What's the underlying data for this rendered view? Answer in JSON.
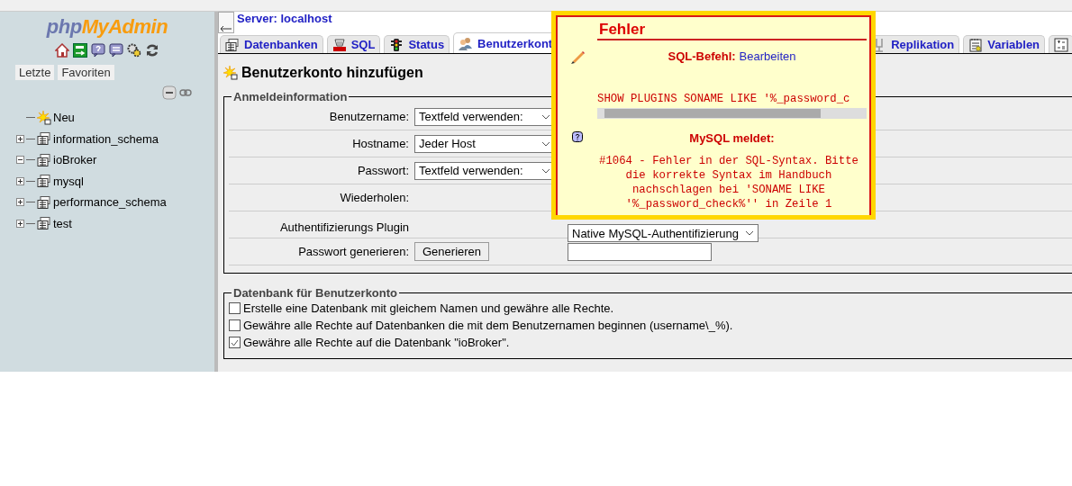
{
  "sidebar": {
    "logo": {
      "prefix": "php",
      "name": "MyAdmin"
    },
    "nav_buttons": [
      "Letzte",
      "Favoriten"
    ],
    "tree": [
      {
        "label": "Neu",
        "kind": "new"
      },
      {
        "label": "information_schema",
        "kind": "db",
        "expanded": false
      },
      {
        "label": "ioBroker",
        "kind": "db",
        "expanded": true
      },
      {
        "label": "mysql",
        "kind": "db",
        "expanded": false
      },
      {
        "label": "performance_schema",
        "kind": "db",
        "expanded": false
      },
      {
        "label": "test",
        "kind": "db",
        "expanded": false
      }
    ]
  },
  "main": {
    "server": "Server: localhost",
    "tabs": [
      {
        "label": "Datenbanken",
        "selected": false
      },
      {
        "label": "SQL",
        "selected": false
      },
      {
        "label": "Status",
        "selected": false
      },
      {
        "label": "Benutzerkont",
        "selected": true
      },
      {
        "label": "Replikation",
        "selected": false
      },
      {
        "label": "Variablen",
        "selected": false
      },
      {
        "selected": false
      }
    ],
    "heading": "Benutzerkonto hinzufügen",
    "login": {
      "legend": "Anmeldeinformation",
      "rows": [
        {
          "label": "Benutzername:",
          "kind": "select",
          "value": "Textfeld verwenden:"
        },
        {
          "label": "Hostname:",
          "kind": "select",
          "value": "Jeder Host"
        },
        {
          "label": "Passwort:",
          "kind": "select",
          "value": "Textfeld verwenden:"
        },
        {
          "label": "Wiederholen:",
          "kind": "empty"
        },
        {
          "label": "Authentifizierungs Plugin",
          "kind": "plugin",
          "value": "Native MySQL-Authentifizierung"
        },
        {
          "label": "Passwort generieren:",
          "kind": "generate",
          "button": "Generieren"
        }
      ]
    },
    "database": {
      "legend": "Datenbank für Benutzerkonto",
      "options": [
        {
          "label": "Erstelle eine Datenbank mit gleichem Namen und gewähre alle Rechte.",
          "checked": false
        },
        {
          "label": "Gewähre alle Rechte auf Datenbanken die mit dem Benutzernamen beginnen (username\\_%).",
          "checked": false
        },
        {
          "label": "Gewähre alle Rechte auf die Datenbank \"ioBroker\".",
          "checked": true
        }
      ]
    }
  },
  "error": {
    "title": "Fehler",
    "sql_label": "SQL-Befehl:",
    "edit_link": "Bearbeiten",
    "query": "SHOW PLUGINS SONAME LIKE '%_password_c",
    "reply_label": "MySQL meldet:",
    "message": "#1064 - Fehler in der SQL-Syntax. Bitte die korrekte Syntax im Handbuch nachschlagen bei 'SONAME LIKE '%_password_check%'' in Zeile 1"
  }
}
